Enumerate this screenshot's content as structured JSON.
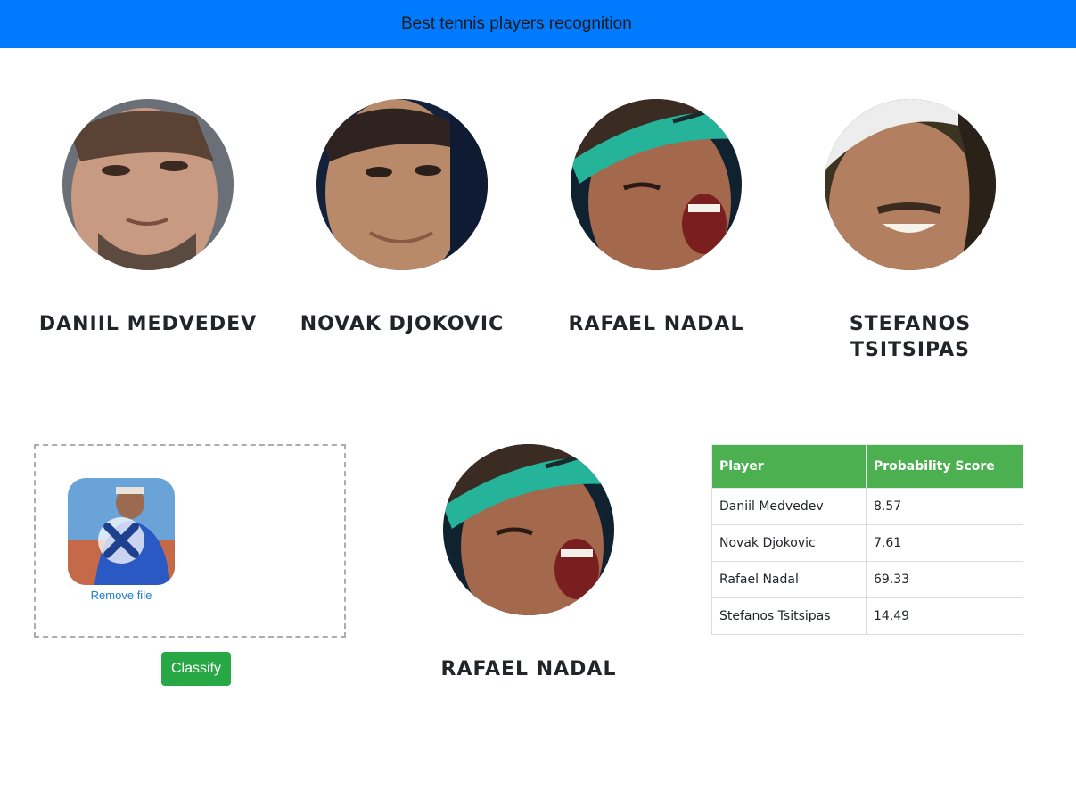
{
  "navbar": {
    "title": "Best tennis players recognition",
    "color": "#007bff"
  },
  "players": [
    {
      "name": "Daniil Medvedev"
    },
    {
      "name": "Novak Djokovic"
    },
    {
      "name": "Rafael Nadal"
    },
    {
      "name": "Stefanos Tsitsipas"
    }
  ],
  "upload": {
    "remove_label": "Remove file"
  },
  "classify": {
    "label": "Classify",
    "color": "#28a745"
  },
  "result": {
    "name": "Rafael Nadal"
  },
  "table": {
    "headers": [
      "Player",
      "Probability Score"
    ],
    "header_color": "#4caf50",
    "rows": [
      [
        "Daniil Medvedev",
        "8.57"
      ],
      [
        "Novak Djokovic",
        "7.61"
      ],
      [
        "Rafael Nadal",
        "69.33"
      ],
      [
        "Stefanos Tsitsipas",
        "14.49"
      ]
    ]
  }
}
